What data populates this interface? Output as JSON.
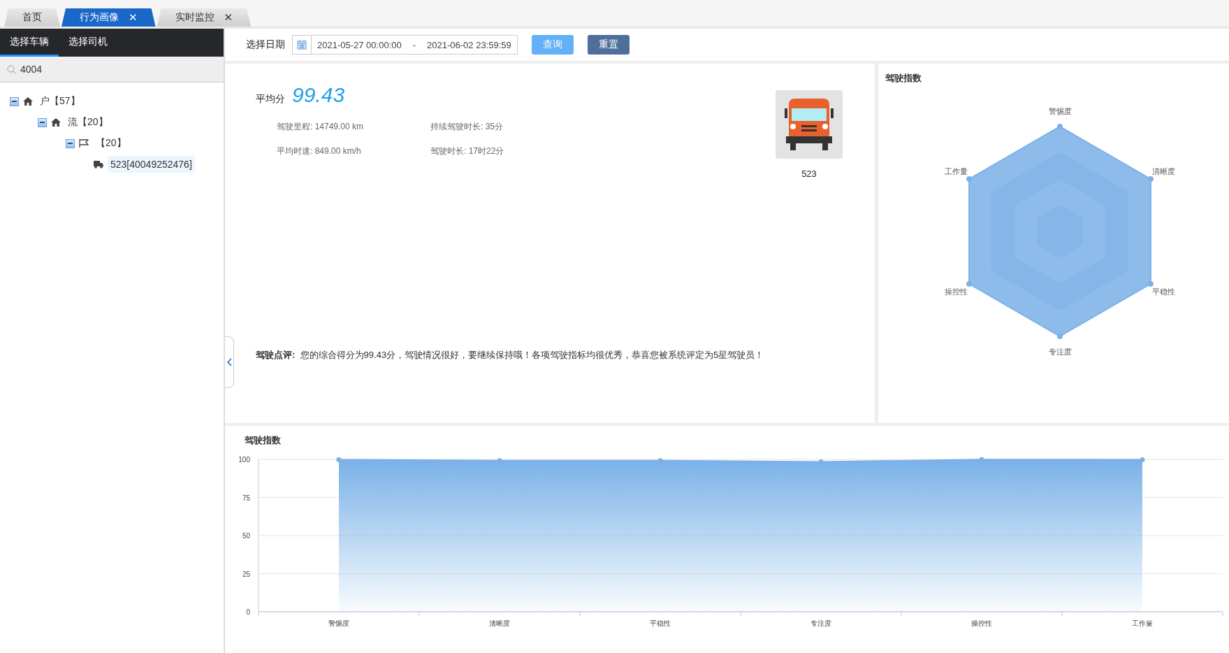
{
  "tabs": [
    {
      "label": "首页",
      "selected": false
    },
    {
      "label": "行为画像",
      "selected": true,
      "close": "✕"
    },
    {
      "label": "实时监控",
      "selected": false,
      "close": "✕"
    }
  ],
  "sidebar": {
    "tabs": [
      {
        "label": "选择车辆",
        "selected": true
      },
      {
        "label": "选择司机",
        "selected": false
      }
    ],
    "search": {
      "value": "4004"
    },
    "tree": [
      {
        "kind": "home",
        "label": "户【57】",
        "expanded": true,
        "selected": false,
        "children": [
          {
            "kind": "home",
            "label": "流【20】",
            "expanded": true,
            "selected": false,
            "children": [
              {
                "kind": "flag",
                "label": "【20】",
                "expanded": true,
                "selected": false,
                "children": [
                  {
                    "kind": "truck",
                    "label": "523[40049252476]",
                    "selected": true
                  }
                ]
              }
            ]
          }
        ]
      }
    ]
  },
  "toolbar": {
    "date_label": "选择日期",
    "start": "2021-05-27 00:00:00",
    "separator": "-",
    "end": "2021-06-02 23:59:59",
    "buttons": [
      {
        "label": "查询",
        "kind": "primary"
      },
      {
        "label": "重置",
        "kind": "secondary"
      }
    ]
  },
  "summary": {
    "score_label": "平均分",
    "score": "99.43",
    "stats": [
      {
        "label": "驾驶里程: 14749.00 km"
      },
      {
        "label": "持续驾驶时长: 35分"
      },
      {
        "label": "平均时速: 849.00 km/h"
      },
      {
        "label": "驾驶时长: 17时22分"
      }
    ],
    "vehicle_name": "523",
    "comment_label": "驾驶点评:",
    "comment": "您的综合得分为99.43分，驾驶情况很好，要继续保持哦！各项驾驶指标均很优秀，恭喜您被系统评定为5星驾驶员！"
  },
  "radar": {
    "title": "驾驶指数",
    "axes": [
      "警惕度",
      "清晰度",
      "平稳性",
      "专注度",
      "操控性",
      "工作量"
    ]
  },
  "trend": {
    "title": "驾驶指数",
    "chart_data": {
      "type": "area",
      "categories": [
        "警惕度",
        "清晰度",
        "平稳性",
        "专注度",
        "操控性",
        "工作量"
      ],
      "grid": true,
      "series": [
        {
          "color": "#7ab1e8",
          "values": [
            99.8,
            99.2,
            99.2,
            98.4,
            99.9,
            99.8
          ]
        }
      ],
      "ylim": [
        0,
        100
      ],
      "yticks": [
        0,
        25,
        50,
        75,
        100
      ]
    }
  }
}
